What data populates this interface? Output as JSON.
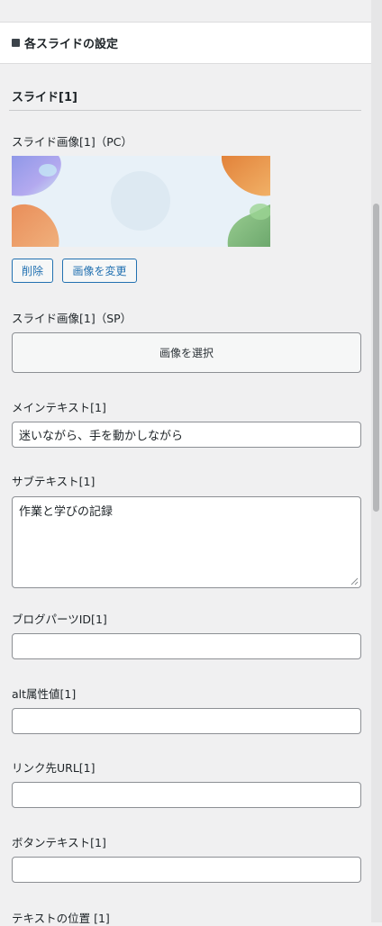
{
  "section": {
    "title": "各スライドの設定"
  },
  "slide": {
    "heading": "スライド[1]"
  },
  "pc_image": {
    "label": "スライド画像[1]（PC）",
    "delete_label": "削除",
    "change_label": "画像を変更"
  },
  "sp_image": {
    "label": "スライド画像[1]（SP）",
    "select_label": "画像を選択"
  },
  "main_text": {
    "label": "メインテキスト[1]",
    "value": "迷いながら、手を動かしながら"
  },
  "sub_text": {
    "label": "サブテキスト[1]",
    "value": "作業と学びの記録"
  },
  "blog_parts": {
    "label": "ブログパーツID[1]",
    "value": ""
  },
  "alt": {
    "label": "alt属性値[1]",
    "value": ""
  },
  "link": {
    "label": "リンク先URL[1]",
    "value": ""
  },
  "button_text": {
    "label": "ボタンテキスト[1]",
    "value": ""
  },
  "text_position": {
    "label": "テキストの位置 [1]"
  },
  "colors": {
    "accent": "#2271b1",
    "border": "#8c8f94",
    "panel": "#f0f0f1"
  },
  "icons": [
    "square-bullet-icon",
    "resize-grip-icon"
  ]
}
